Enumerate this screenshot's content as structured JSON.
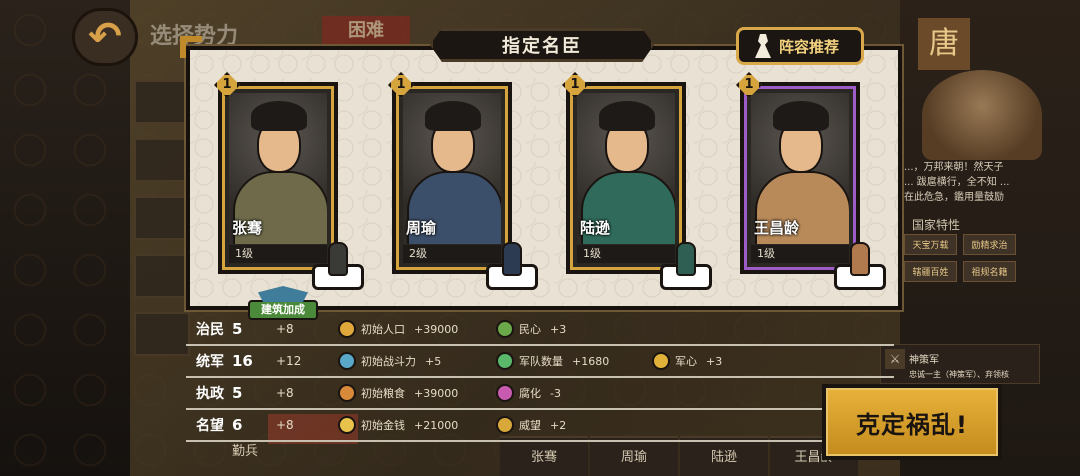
{
  "background": {
    "title": "选择势力",
    "difficulty": "困难",
    "dynasty": "唐",
    "description": "...，万邦来朝！然天子 ... 跋扈横行，全不知 ... 在此危急，鑑用量鼓励",
    "traits_title": "国家特性",
    "traits": [
      "天宝万载",
      "励精求治",
      "辖疆百姓",
      "祖规名籍"
    ],
    "army": {
      "name": "神策军",
      "sub": "忠诚一主（神策军）、弃领核"
    },
    "bottom_tabs": [
      "张骞",
      "周瑜",
      "陆逊",
      "王昌龄"
    ],
    "bottom_small": "勤兵"
  },
  "modal": {
    "title": "指定名臣",
    "recommend_label": "阵容推荐"
  },
  "cards": [
    {
      "name": "张骞",
      "level": "1级",
      "rank": "1",
      "frame": "gold",
      "robe": "#6e6a4a",
      "chibi": "#3a3a36"
    },
    {
      "name": "周瑜",
      "level": "2级",
      "rank": "1",
      "frame": "gold",
      "robe": "#3c4f6a",
      "chibi": "#2d3b52"
    },
    {
      "name": "陆逊",
      "level": "1级",
      "rank": "1",
      "frame": "gold",
      "robe": "#2f6a5a",
      "chibi": "#2f5e52"
    },
    {
      "name": "王昌龄",
      "level": "1级",
      "rank": "1",
      "frame": "purple",
      "robe": "#b88a5a",
      "chibi": "#b07a4e"
    }
  ],
  "build_bonus_label": "建筑加成",
  "stats": [
    {
      "label": "治民",
      "value": "5",
      "bonus": "+8",
      "effects": [
        {
          "icon": "population-icon",
          "color": "#e0a83a",
          "name": "初始人口",
          "value": "+39000"
        },
        {
          "icon": "popularity-icon",
          "color": "#6aa84a",
          "name": "民心",
          "value": "+3"
        }
      ]
    },
    {
      "label": "统军",
      "value": "16",
      "bonus": "+12",
      "effects": [
        {
          "icon": "combat-icon",
          "color": "#5aa8c8",
          "name": "初始战斗力",
          "value": "+5"
        },
        {
          "icon": "troops-icon",
          "color": "#5ab86a",
          "name": "军队数量",
          "value": "+1680"
        },
        {
          "icon": "morale-icon",
          "color": "#e0b23a",
          "name": "军心",
          "value": "+3"
        }
      ]
    },
    {
      "label": "执政",
      "value": "5",
      "bonus": "+8",
      "effects": [
        {
          "icon": "food-icon",
          "color": "#d88a3a",
          "name": "初始粮食",
          "value": "+39000"
        },
        {
          "icon": "corruption-icon",
          "color": "#c85ab0",
          "name": "腐化",
          "value": "-3"
        }
      ]
    },
    {
      "label": "名望",
      "value": "6",
      "bonus": "+8",
      "effects": [
        {
          "icon": "gold-icon",
          "color": "#e8c24a",
          "name": "初始金钱",
          "value": "+21000"
        },
        {
          "icon": "prestige-icon",
          "color": "#d8a83a",
          "name": "威望",
          "value": "+2"
        }
      ]
    }
  ],
  "confirm_label": "克定祸乱!"
}
